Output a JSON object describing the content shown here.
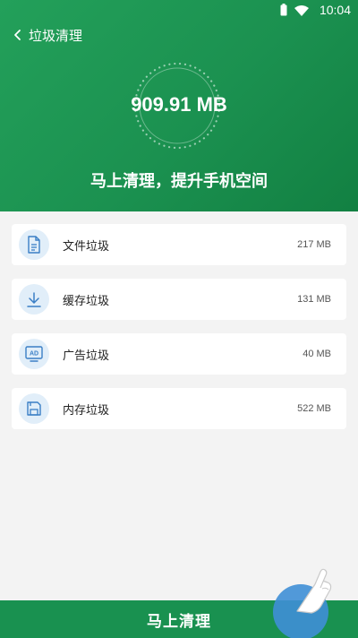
{
  "status_bar": {
    "time": "10:04",
    "wifi_icon": "wifi-icon",
    "battery_icon": "battery-icon"
  },
  "nav": {
    "back_icon": "chevron-left-icon",
    "title": "垃圾清理"
  },
  "summary": {
    "total_size": "909.91 MB",
    "slogan": "马上清理，提升手机空间"
  },
  "items": [
    {
      "label": "文件垃圾",
      "size": "217 MB",
      "icon": "file-icon"
    },
    {
      "label": "缓存垃圾",
      "size": "131 MB",
      "icon": "download-icon"
    },
    {
      "label": "广告垃圾",
      "size": "40 MB",
      "icon": "ad-icon"
    },
    {
      "label": "内存垃圾",
      "size": "522 MB",
      "icon": "floppy-icon"
    }
  ],
  "bottom": {
    "clean_button_label": "马上清理",
    "hand_icon": "pointing-hand-icon"
  },
  "colors": {
    "header_green": "#1b9150",
    "bottom_green": "#199150",
    "icon_blue": "#3a7fc6",
    "icon_bg": "#e1eef9",
    "page_bg": "#f3f3f3"
  }
}
